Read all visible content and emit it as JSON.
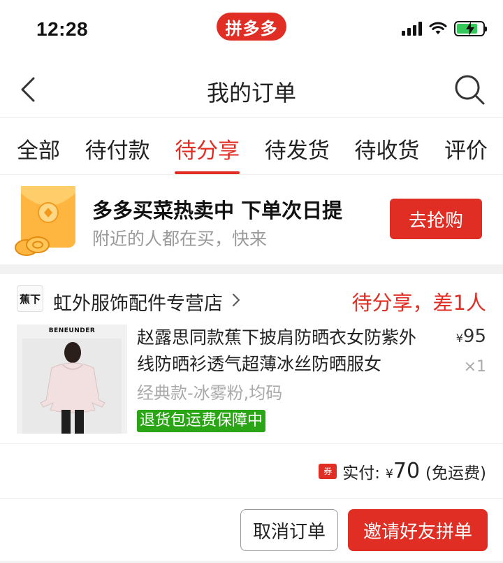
{
  "status_bar": {
    "time": "12:28",
    "brand": "拼多多",
    "icons": [
      "cellular-signal-icon",
      "wifi-icon",
      "battery-charging-icon"
    ],
    "battery_level": 0.8
  },
  "nav": {
    "title": "我的订单",
    "back_icon": "chevron-left-icon",
    "search_icon": "search-icon"
  },
  "tabs": [
    {
      "label": "全部",
      "active": false
    },
    {
      "label": "待付款",
      "active": false
    },
    {
      "label": "待分享",
      "active": true
    },
    {
      "label": "待发货",
      "active": false
    },
    {
      "label": "待收货",
      "active": false
    },
    {
      "label": "评价",
      "active": false
    }
  ],
  "promo": {
    "title": "多多买菜热卖中 下单次日提",
    "subtitle": "附近的人都在买，快来",
    "button": "去抢购",
    "icon": "red-envelope-coin-icon"
  },
  "order": {
    "store_logo_text": "蕉下",
    "store_name": "虹外服饰配件专营店",
    "status": "待分享，差1人",
    "product": {
      "image_brand": "BENEUNDER",
      "title": "赵露思同款蕉下披肩防晒衣女防紫外线防晒衫透气超薄冰丝防晒服女",
      "price_symbol": "¥",
      "price": "95",
      "quantity": "×1",
      "spec": "经典款-冰雾粉,均码",
      "guarantee": "退货包运费保障中"
    },
    "payment": {
      "coupon_icon_text": "券",
      "label": "实付:",
      "symbol": "¥",
      "amount": "70",
      "note": "(免运费)"
    },
    "actions": {
      "cancel": "取消订单",
      "invite": "邀请好友拼单"
    }
  },
  "colors": {
    "accent": "#e02e24",
    "guarantee_green": "#2aa515",
    "muted_text": "#999999"
  }
}
